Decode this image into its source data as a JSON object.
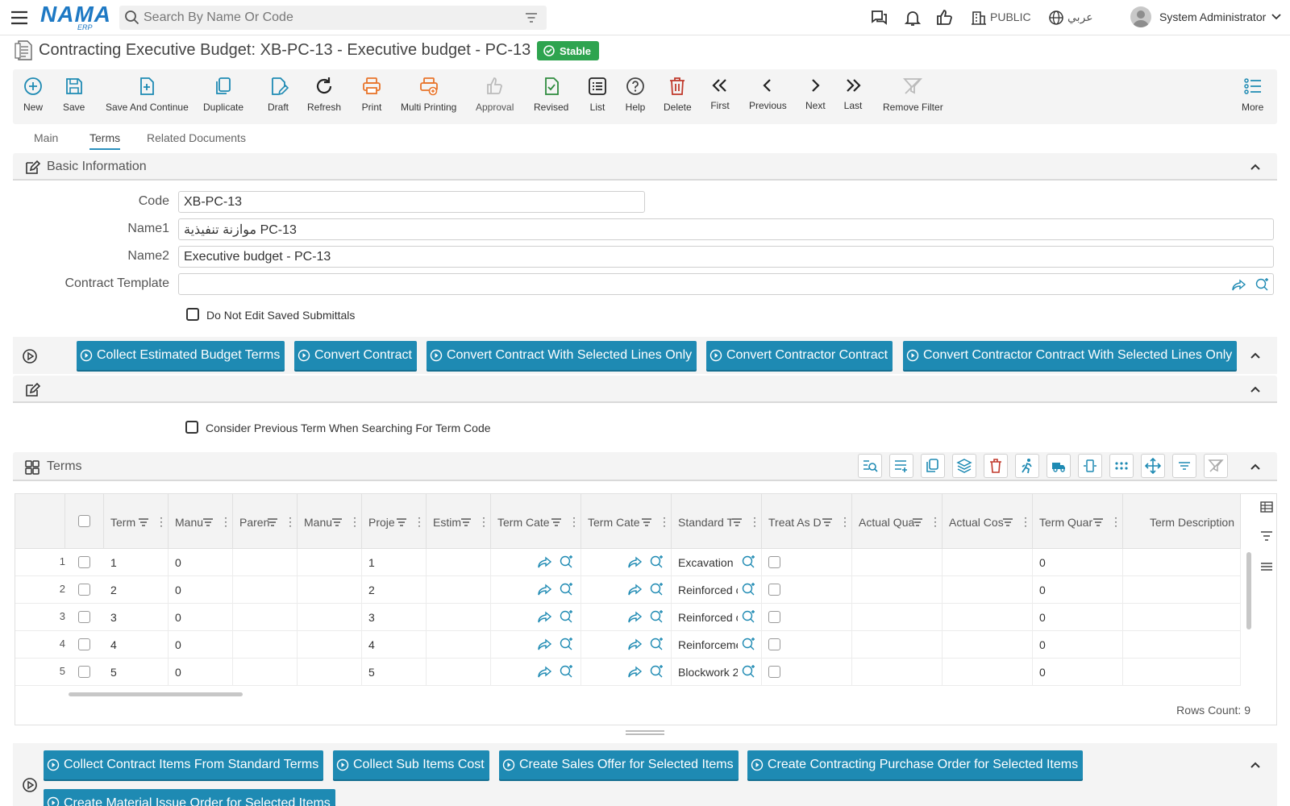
{
  "topbar": {
    "search_placeholder": "Search By Name Or Code",
    "company": "PUBLIC",
    "language": "عربي",
    "user": "System Administrator",
    "logo_main": "NAMA",
    "logo_sub": "ERP"
  },
  "title": {
    "text": "Contracting Executive Budget: XB-PC-13 - Executive budget - PC-13",
    "badge": "Stable"
  },
  "toolbar": [
    {
      "label": "New",
      "icon": "plus-circle-icon"
    },
    {
      "label": "Save",
      "icon": "save-icon"
    },
    {
      "label": "Save And Continue",
      "icon": "file-plus-icon"
    },
    {
      "label": "Duplicate",
      "icon": "copy-icon"
    },
    {
      "label": "Draft",
      "icon": "file-edit-icon"
    },
    {
      "label": "Refresh",
      "icon": "refresh-icon"
    },
    {
      "label": "Print",
      "icon": "printer-icon"
    },
    {
      "label": "Multi Printing",
      "icon": "multi-printer-icon"
    },
    {
      "label": "Approval",
      "icon": "thumbs-up-icon"
    },
    {
      "label": "Revised",
      "icon": "file-check-icon"
    },
    {
      "label": "List",
      "icon": "list-icon"
    },
    {
      "label": "Help",
      "icon": "help-icon"
    },
    {
      "label": "Delete",
      "icon": "trash-icon"
    },
    {
      "label": "First",
      "icon": "double-chevron-left-icon"
    },
    {
      "label": "Previous",
      "icon": "chevron-left-icon"
    },
    {
      "label": "Next",
      "icon": "chevron-right-icon"
    },
    {
      "label": "Last",
      "icon": "double-chevron-right-icon"
    },
    {
      "label": "Remove Filter",
      "icon": "filter-off-icon"
    },
    {
      "label": "More",
      "icon": "more-list-icon"
    }
  ],
  "tabs": [
    "Main",
    "Terms",
    "Related Documents"
  ],
  "basic_info": {
    "title": "Basic Information",
    "code_label": "Code",
    "code_value": "XB-PC-13",
    "name1_label": "Name1",
    "name1_value": "موازنة تنفيذية PC-13",
    "name2_label": "Name2",
    "name2_value": "Executive budget - PC-13",
    "template_label": "Contract Template",
    "template_value": "",
    "do_not_edit_label": "Do Not Edit Saved Submittals"
  },
  "actions1": [
    "Collect Estimated Budget Terms",
    "Convert Contract",
    "Convert Contract With Selected Lines Only",
    "Convert Contractor Contract",
    "Convert Contractor Contract With Selected Lines Only"
  ],
  "consider_label": "Consider Previous Term When Searching For Term Code",
  "terms": {
    "title": "Terms",
    "columns": [
      "Term",
      "Manu",
      "Paren",
      "Manu",
      "Proje",
      "Estim",
      "Term Cate",
      "Term Cate",
      "Standard T",
      "Treat As D",
      "Actual Qua",
      "Actual Cos",
      "Term Quar",
      "Term Description"
    ],
    "rows": [
      {
        "n": "1",
        "term": "1",
        "manu": "0",
        "proj": "1",
        "std": "Excavation",
        "qty": "0"
      },
      {
        "n": "2",
        "term": "2",
        "manu": "0",
        "proj": "2",
        "std": "Reinforced c",
        "qty": "0"
      },
      {
        "n": "3",
        "term": "3",
        "manu": "0",
        "proj": "3",
        "std": "Reinforced c",
        "qty": "0"
      },
      {
        "n": "4",
        "term": "4",
        "manu": "0",
        "proj": "4",
        "std": "Reinforceme",
        "qty": "0"
      },
      {
        "n": "5",
        "term": "5",
        "manu": "0",
        "proj": "5",
        "std": "Blockwork 2",
        "qty": "0"
      }
    ],
    "rows_count": "Rows Count: 9"
  },
  "actions2": [
    "Collect Contract Items From Standard Terms",
    "Collect Sub Items Cost",
    "Create Sales Offer for Selected Items",
    "Create Contracting Purchase Order for Selected Items",
    "Create Material Issue Order for Selected Items"
  ],
  "colors": {
    "accent": "#1e8ab3",
    "badge": "#2ea44f",
    "danger": "#c0392b",
    "print": "#e8742a"
  }
}
